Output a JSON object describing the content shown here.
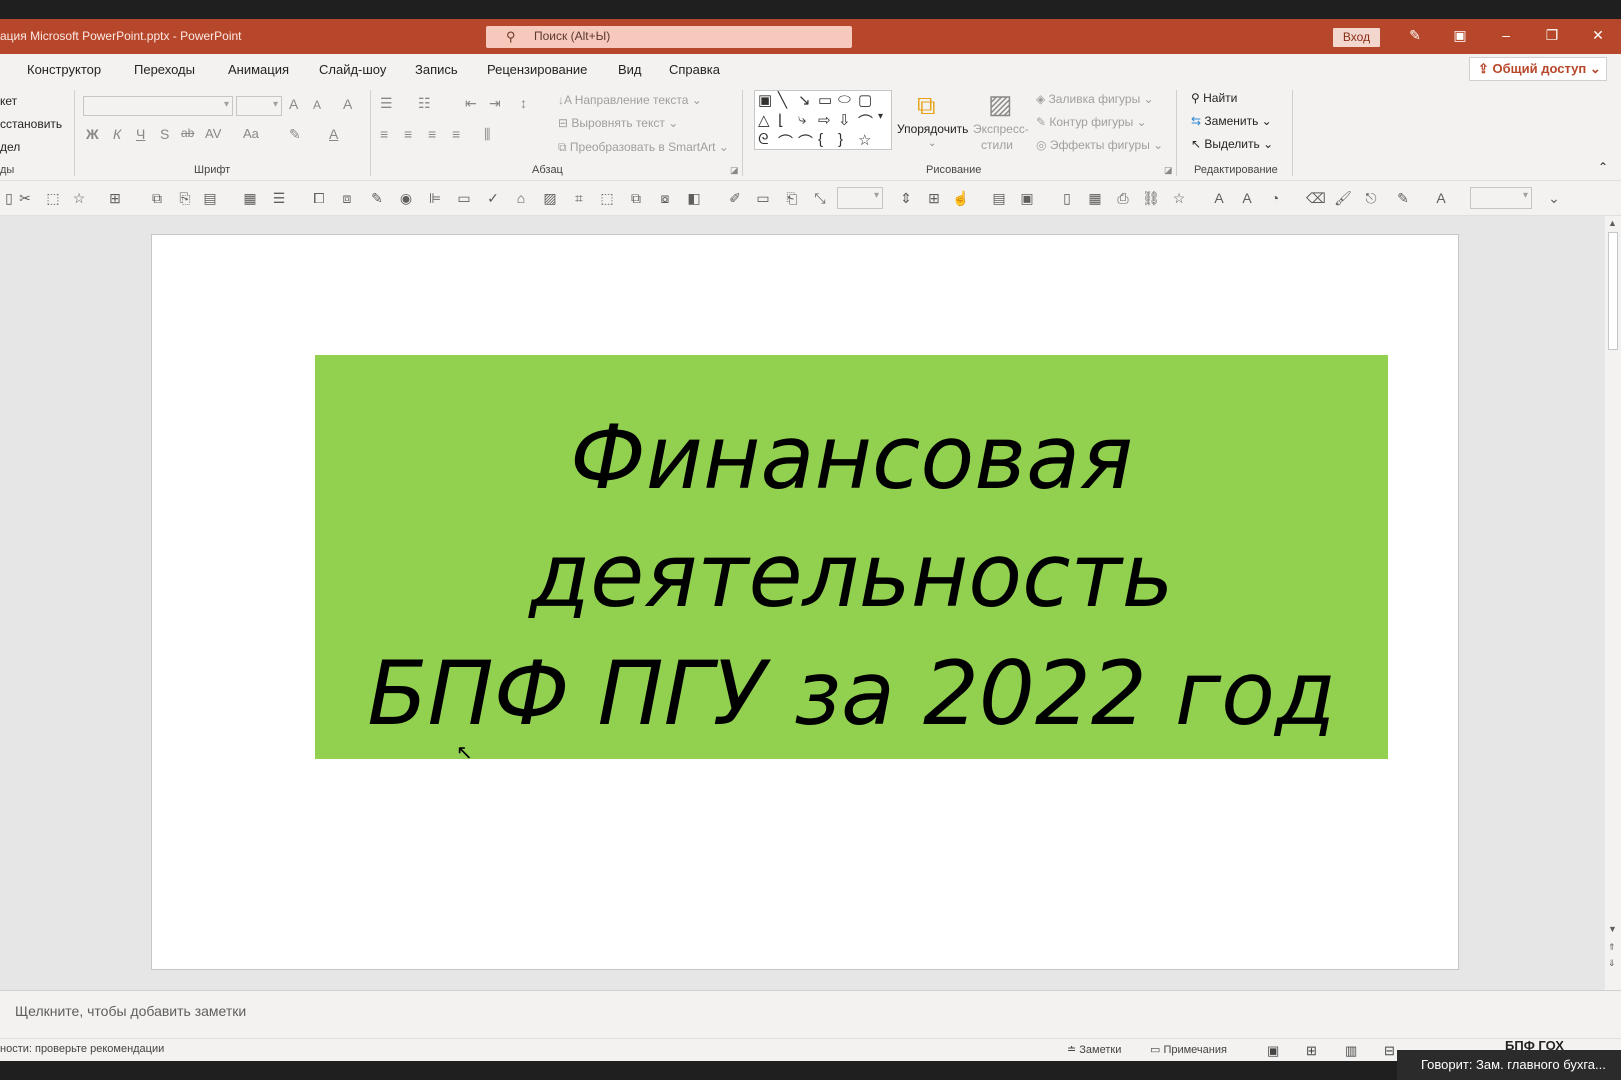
{
  "app": {
    "window_title": "ация Microsoft PowerPoint.pptx  -  PowerPoint",
    "search_placeholder": "Поиск (Alt+Ы)",
    "signin": "Вход"
  },
  "tabs": [
    "Конструктор",
    "Переходы",
    "Анимация",
    "Слайд-шоу",
    "Запись",
    "Рецензирование",
    "Вид",
    "Справка"
  ],
  "share_label": "Общий доступ",
  "ribbon": {
    "slides_group": {
      "layout": "кет",
      "reset": "сстановить",
      "section": "дел",
      "label": "ды"
    },
    "font": {
      "bold": "Ж",
      "italic": "К",
      "underline": "Ч",
      "shadow": "S",
      "strike": "ab",
      "spacing": "AV",
      "case": "Aa",
      "grow": "A",
      "shrink": "A",
      "clear": "A",
      "color_a": "A",
      "label": "Шрифт"
    },
    "paragraph": {
      "direction": "Направление текста",
      "align_text": "Выровнять текст",
      "smartart": "Преобразовать в SmartArt",
      "label": "Абзац"
    },
    "drawing": {
      "arrange": "Упорядочить",
      "quick_styles_1": "Экспресс-",
      "quick_styles_2": "стили",
      "fill": "Заливка фигуры",
      "outline": "Контур фигуры",
      "effects": "Эффекты фигуры",
      "label": "Рисование"
    },
    "editing": {
      "find": "Найти",
      "replace": "Заменить",
      "select": "Выделить",
      "label": "Редактирование"
    }
  },
  "slide": {
    "title_line1": "Финансовая",
    "title_line2": "деятельность",
    "title_line3": "БПФ ПГУ за 2022 год",
    "title_fill": "#92d050"
  },
  "notes_placeholder": "Щелкните, чтобы добавить заметки",
  "status": {
    "left": "ности: проверьте рекомендации",
    "notes": "Заметки",
    "comments": "Примечания"
  },
  "toast": {
    "speaker": "Говорит: Зам. главного бухга...",
    "label": "БПФ ГОХ"
  },
  "colors": {
    "accent": "#b7472a",
    "slide_box": "#92d050"
  }
}
